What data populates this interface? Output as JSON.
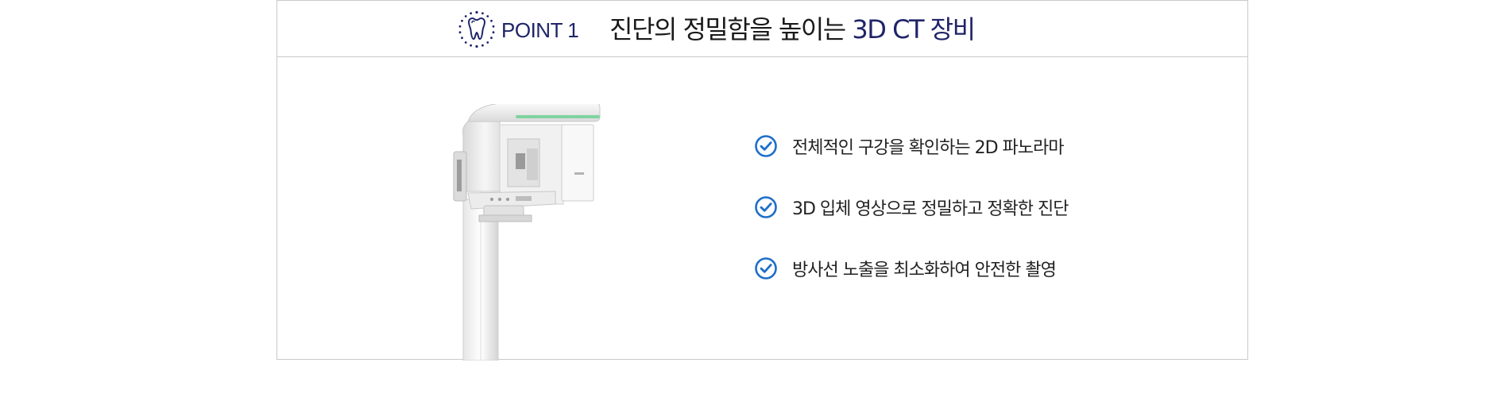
{
  "header": {
    "icon": "tooth-icon",
    "point_label": "POINT 1",
    "headline_main": "진단의 정밀함을 높이는 ",
    "headline_accent": "3D CT 장비"
  },
  "device_image": {
    "icon": "ct-scanner-illustration"
  },
  "features": [
    {
      "icon": "check-circle-icon",
      "text": "전체적인 구강을 확인하는 2D 파노라마"
    },
    {
      "icon": "check-circle-icon",
      "text": "3D 입체 영상으로 정밀하고 정확한 진단"
    },
    {
      "icon": "check-circle-icon",
      "text": "방사선 노출을 최소화하여 안전한 촬영"
    }
  ],
  "colors": {
    "accent_navy": "#1f2468",
    "check_blue": "#1e6fc8",
    "device_green": "#7fd3a0",
    "border": "#c9c9c9"
  }
}
